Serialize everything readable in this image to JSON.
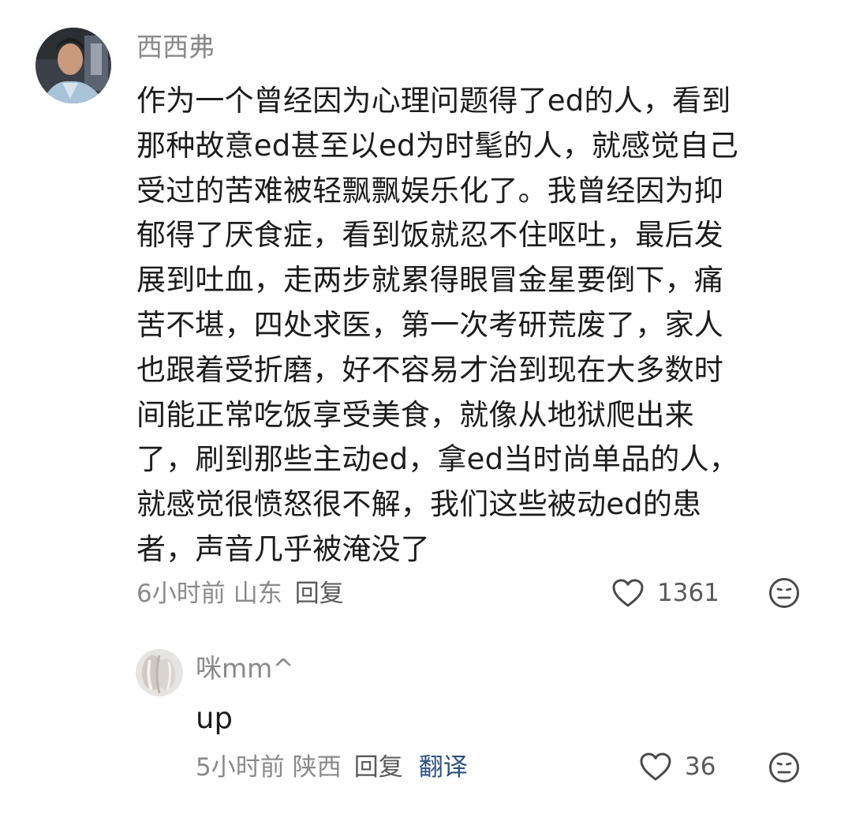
{
  "comment": {
    "username": "西西弗",
    "text": "作为一个曾经因为心理问题得了ed的人，看到\n那种故意ed甚至以ed为时髦的人，就感觉自己\n受过的苦难被轻飘飘娱乐化了。我曾经因为抑\n郁得了厌食症，看到饭就忍不住呕吐，最后发\n展到吐血，走两步就累得眼冒金星要倒下，痛\n苦不堪，四处求医，第一次考研荒废了，家人\n也跟着受折磨，好不容易才治到现在大多数时\n间能正常吃饭享受美食，就像从地狱爬出来\n了，刷到那些主动ed，拿ed当时尚单品的人，\n就感觉很愤怒很不解，我们这些被动ed的患\n者，声音几乎被淹没了",
    "time": "6小时前",
    "location": "山东",
    "reply_label": "回复",
    "like_count": "1361",
    "like_icon": "heart-outline-icon",
    "dislike_icon": "unhappy-face-icon"
  },
  "reply": {
    "username": "咪mm^",
    "text": "up",
    "time": "5小时前",
    "location": "陕西",
    "reply_label": "回复",
    "translate_label": "翻译",
    "like_count": "36",
    "like_icon": "heart-outline-icon",
    "dislike_icon": "unhappy-face-icon"
  },
  "colors": {
    "meta_gray": "#8a8a8a",
    "translate_blue": "#2b4f80",
    "text": "#1c1c1c"
  }
}
